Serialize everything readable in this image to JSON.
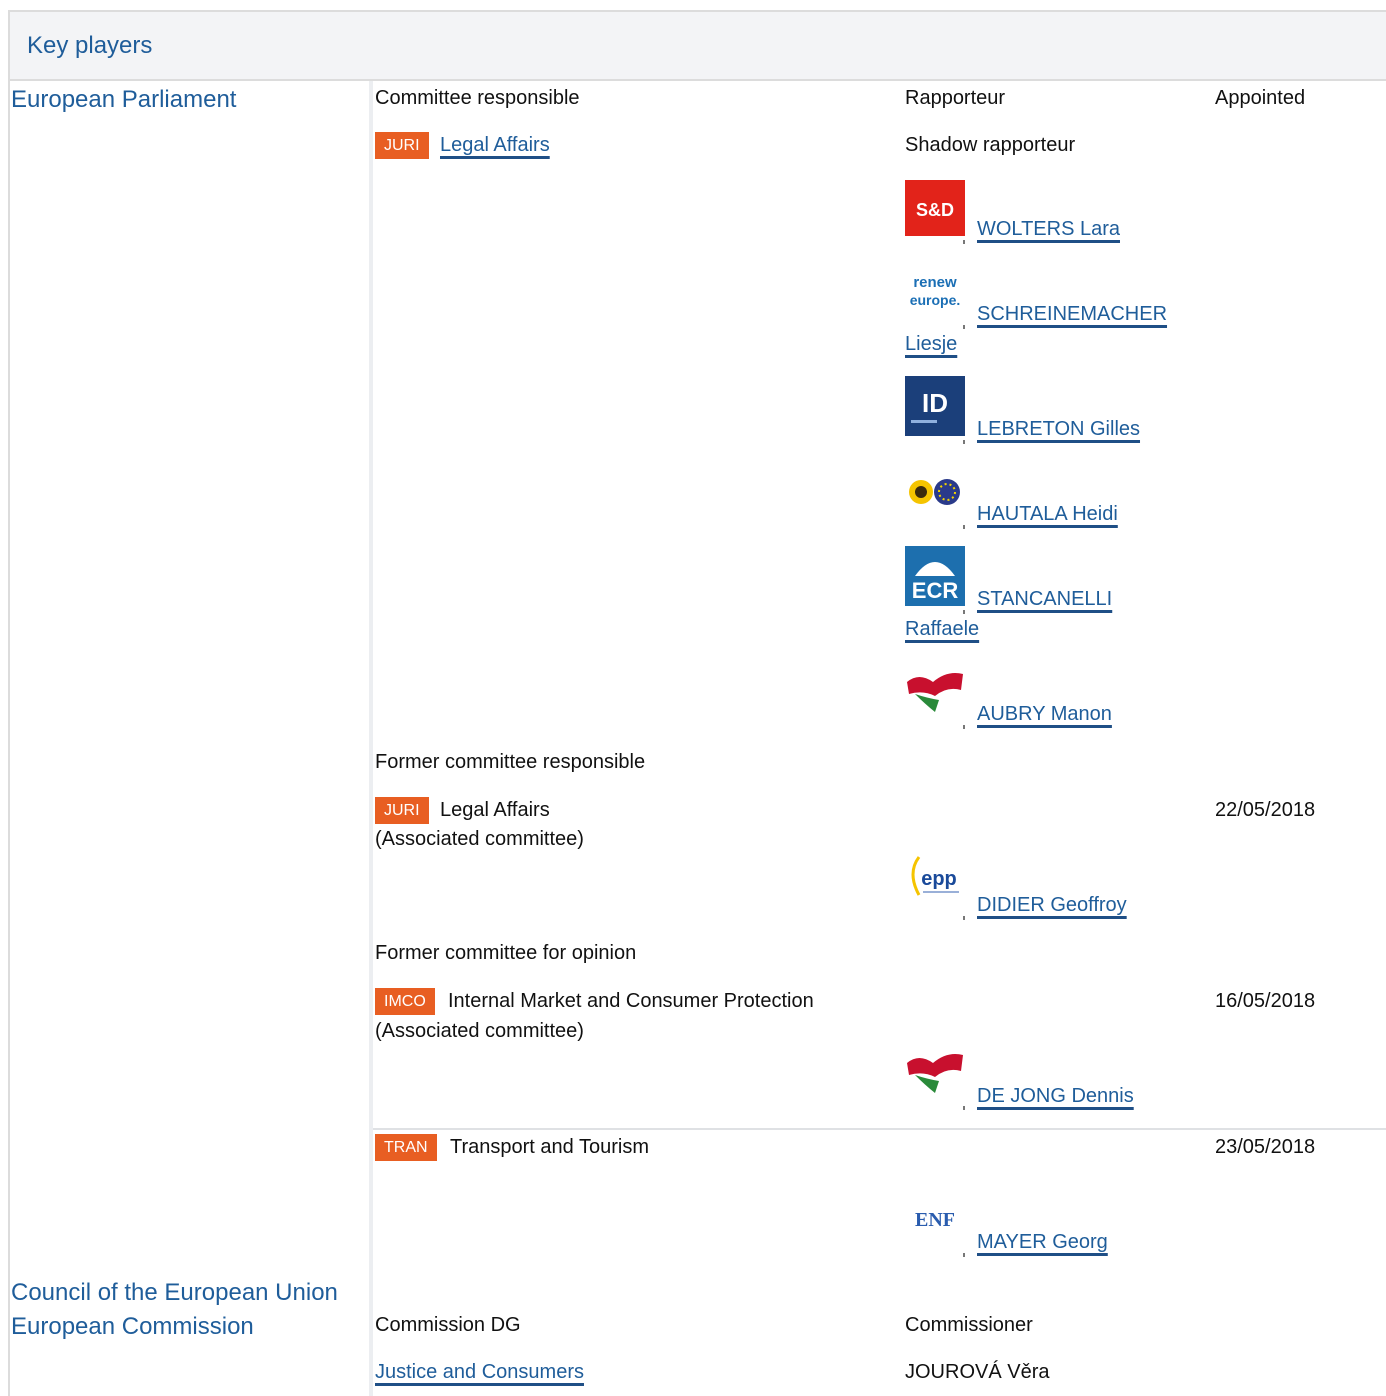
{
  "section": {
    "title": "Key players"
  },
  "institutions": {
    "ep": "European Parliament",
    "council": "Council of the European Union",
    "commission": "European Commission"
  },
  "headers": {
    "committee_responsible": "Committee responsible",
    "rapporteur": "Rapporteur",
    "appointed": "Appointed",
    "shadow_rapporteur": "Shadow rapporteur",
    "former_committee_responsible": "Former committee responsible",
    "former_committee_opinion": "Former committee for opinion",
    "commission_dg": "Commission DG",
    "commissioner": "Commissioner"
  },
  "committee": {
    "code": "JURI",
    "name": "Legal Affairs"
  },
  "shadow_rapporteurs": [
    {
      "name_line1": "WOLTERS Lara",
      "name_line2": "",
      "group_logo_text": "S&D",
      "group_icon": "sd-group-logo"
    },
    {
      "name_line1": "SCHREINEMACHER",
      "name_line2": "Liesje",
      "group_logo_text": "renew europe.",
      "group_icon": "renew-europe-logo"
    },
    {
      "name_line1": "LEBRETON Gilles",
      "name_line2": "",
      "group_logo_text": "ID",
      "group_icon": "id-group-logo"
    },
    {
      "name_line1": "HAUTALA Heidi",
      "name_line2": "",
      "group_logo_text": "",
      "group_icon": "greens-efa-logo"
    },
    {
      "name_line1": "STANCANELLI",
      "name_line2": "Raffaele",
      "group_logo_text": "ECR",
      "group_icon": "ecr-group-logo"
    },
    {
      "name_line1": "AUBRY Manon",
      "name_line2": "",
      "group_logo_text": "",
      "group_icon": "gue-ngl-logo"
    }
  ],
  "former_responsible": {
    "code": "JURI",
    "name": "Legal Affairs",
    "note": "(Associated committee)",
    "appointed": "22/05/2018",
    "rapporteur": "DIDIER Geoffroy",
    "group_logo_text": "epp",
    "group_icon": "epp-group-logo"
  },
  "former_opinion": [
    {
      "code": "IMCO",
      "name": "Internal Market and Consumer Protection",
      "note": "(Associated committee)",
      "appointed": "16/05/2018",
      "rapporteur": "DE JONG Dennis",
      "group_logo_text": "",
      "group_icon": "gue-ngl-logo"
    },
    {
      "code": "TRAN",
      "name": "Transport and Tourism",
      "note": "",
      "appointed": "23/05/2018",
      "rapporteur": "MAYER Georg",
      "group_logo_text": "ENF",
      "group_icon": "enf-group-logo"
    }
  ],
  "commission": {
    "dg": "Justice and Consumers",
    "commissioner": "JOUROVÁ Věra"
  },
  "colors": {
    "link": "#1f5d9a",
    "badge": "#e85e22",
    "header_bg": "#f3f4f6",
    "border": "#dcdcdc"
  }
}
